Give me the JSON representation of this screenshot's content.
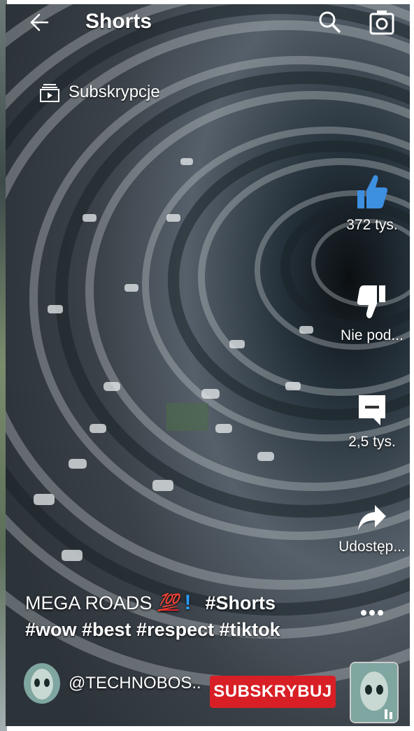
{
  "header": {
    "title": "Shorts"
  },
  "subscriptions": {
    "label": "Subskrypcje"
  },
  "actions": {
    "like": {
      "label": "372 tys."
    },
    "dislike": {
      "label": "Nie pod..."
    },
    "comments": {
      "label": "2,5 tys."
    },
    "share": {
      "label": "Udostęp..."
    }
  },
  "caption": {
    "title": "MEGA ROADS",
    "emoji": "💯",
    "exclaim": "!",
    "tag1": "#Shorts",
    "line2": "#wow #best #respect #tiktok"
  },
  "channel": {
    "handle": "@TECHNOBOS..",
    "subscribe_label": "SUBSKRYBUJ"
  },
  "icons": [
    "back-arrow-icon",
    "search-icon",
    "camera-icon",
    "subscriptions-icon",
    "thumbs-up-icon",
    "thumbs-down-icon",
    "comment-icon",
    "share-icon",
    "more-icon"
  ],
  "colors": {
    "like_blue": "#3d8fe0",
    "subscribe_red": "#d81f26",
    "exclaim_blue": "#2a9bff"
  }
}
